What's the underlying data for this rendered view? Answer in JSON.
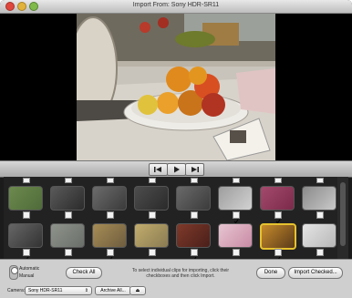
{
  "window": {
    "title": "Import From: Sony HDR-SR11"
  },
  "controls": {
    "prev_icon": "skip-back-icon",
    "play_icon": "play-icon",
    "next_icon": "skip-forward-icon"
  },
  "clips": {
    "rows": [
      [
        {
          "label": "",
          "checked": false
        },
        {
          "label": "",
          "checked": false
        },
        {
          "label": "",
          "checked": false
        },
        {
          "label": "",
          "checked": false
        },
        {
          "label": "",
          "checked": false
        },
        {
          "label": "",
          "checked": true
        },
        {
          "label": "",
          "checked": true
        },
        {
          "label": "",
          "checked": false
        }
      ],
      [
        {
          "label": "",
          "checked": true
        },
        {
          "label": "",
          "checked": false
        },
        {
          "label": "",
          "checked": true
        },
        {
          "label": "",
          "checked": false
        },
        {
          "label": "",
          "checked": true
        },
        {
          "label": "",
          "checked": false
        },
        {
          "label": "",
          "checked": true
        },
        {
          "label": "",
          "checked": false
        }
      ]
    ],
    "selected_index": 14
  },
  "bottom": {
    "mode_automatic": "Automatic",
    "mode_manual": "Manual",
    "check_all": "Check All",
    "hint": "To select individual clips for importing, click their checkboxes and then click Import.",
    "done": "Done",
    "import_checked": "Import Checked...",
    "camera_label": "Camera:",
    "camera_value": "Sony HDR-SR11",
    "archive_all": "Archive All...",
    "eject_icon": "eject-icon"
  }
}
